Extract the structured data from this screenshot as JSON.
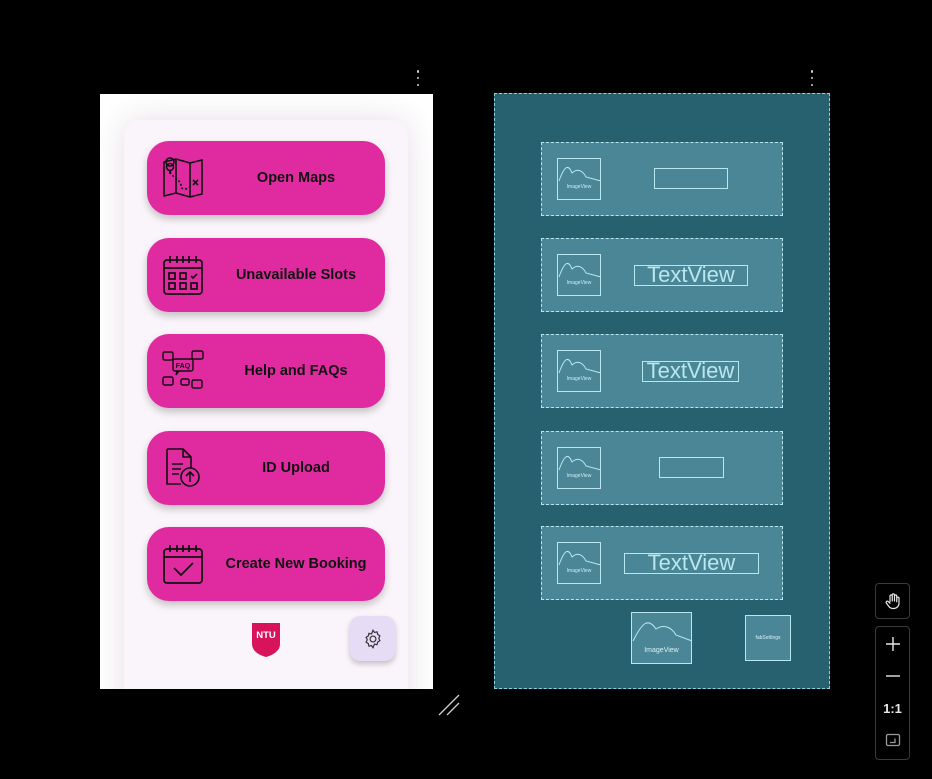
{
  "design": {
    "buttons": [
      {
        "label": "Open Maps",
        "icon": "map-icon"
      },
      {
        "label": "Unavailable Slots",
        "icon": "calendar-grid-icon"
      },
      {
        "label": "Help and FAQs",
        "icon": "faq-chat-icon"
      },
      {
        "label": "ID Upload",
        "icon": "document-upload-icon"
      },
      {
        "label": "Create New Booking",
        "icon": "calendar-check-icon"
      }
    ],
    "logo_text": "NTU",
    "settings_icon": "gear-icon",
    "colors": {
      "button": "#e02ba0",
      "logo": "#d8125b",
      "fab": "#e6dcf5"
    }
  },
  "blueprint": {
    "image_label": "ImageView",
    "text_label": "TextView",
    "fab_label": "fabSettings",
    "colors": {
      "background": "#27606f",
      "row": "#4a8696",
      "outline": "#b9e7f0"
    }
  },
  "zoom_toolbar": {
    "pan_icon": "hand-icon",
    "zoom_in_icon": "plus-icon",
    "zoom_out_icon": "minus-icon",
    "actual_size_label": "1:1",
    "fit_icon": "fit-screen-icon"
  }
}
